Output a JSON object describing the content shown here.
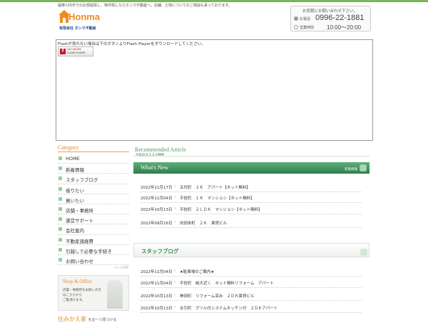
{
  "header": {
    "tagline": "薩摩川内市でのお部屋探し、物件探しならホンマ不動産へ。店舗、土地についてのご相談も承っております。",
    "logo": {
      "name": "Honma",
      "company": "有限会社 ホンマ不動産"
    },
    "contact": {
      "note": "お気軽にお問い合わせ下さい。",
      "tel_label": "お電話",
      "tel": "0996-22-1881",
      "hours_label": "営業時間",
      "hours": "10:00～20:00"
    }
  },
  "flash": {
    "message": "Flashが見れない場合は下のボタンよりFlash Playerをダウンロードしてください。",
    "button_line1": "Get ADOBE",
    "button_line2": "FLASH PLAYER"
  },
  "sidebar": {
    "title": "Category",
    "items": [
      {
        "label": "HOME"
      },
      {
        "label": "新着情報"
      },
      {
        "label": "スタッフブログ"
      },
      {
        "label": "借りたい"
      },
      {
        "label": "買いたい"
      },
      {
        "label": "店舗・事務所"
      },
      {
        "label": "運営サポート"
      },
      {
        "label": "会社案内"
      },
      {
        "label": "不動産諸経費"
      },
      {
        "label": "引越しで必要な手続き"
      },
      {
        "label": "お問い合わせ"
      }
    ],
    "pagetop": "ページTOP",
    "banner": {
      "title": "Shop & Office",
      "line1": "店舗・事務所をお探しの方",
      "line2": "はこちらから",
      "line3": "ご覧頂けます。"
    },
    "sumikae": {
      "title": "住みかえ家",
      "sub": "をお一つ見つける"
    }
  },
  "main": {
    "recommended": {
      "title": "Recommended Article",
      "subtitle": "今日のオススメ物件"
    },
    "whats_new": {
      "title": "What's New",
      "subtitle": "新着情報",
      "items": [
        {
          "date": "2022年11月17日",
          "text": "五代町　２Ｋ　アパート【ネット無料】"
        },
        {
          "date": "2022年11月04日",
          "text": "平佐町　１Ｋ　マンション【ネット無料】"
        },
        {
          "date": "2022年10月13日",
          "text": "平佐町　２ＬＤＫ　マンション【ネット無料】"
        },
        {
          "date": "2022年09月16日",
          "text": "向田本町　２Ｋ　賃貸ビル"
        }
      ]
    },
    "blog": {
      "title": "スタッフブログ",
      "items": [
        {
          "date": "2022年11月04日",
          "text": "★駐車場のご案内★"
        },
        {
          "date": "2022年11月04日",
          "text": "平佐町　純大近く　ネット無料リフォーム　アパート"
        },
        {
          "date": "2022年10月13日",
          "text": "神田町　リフォーム済み　２ＤＫ賃貸ビル"
        },
        {
          "date": "2022年10月13日",
          "text": "水引町　グリル付システムキッチン付　２ＤＫアパート"
        }
      ]
    }
  },
  "colors": {
    "accent_green": "#2f7d4c",
    "accent_orange": "#e08a2a",
    "logo_orange": "#f08c1e"
  }
}
